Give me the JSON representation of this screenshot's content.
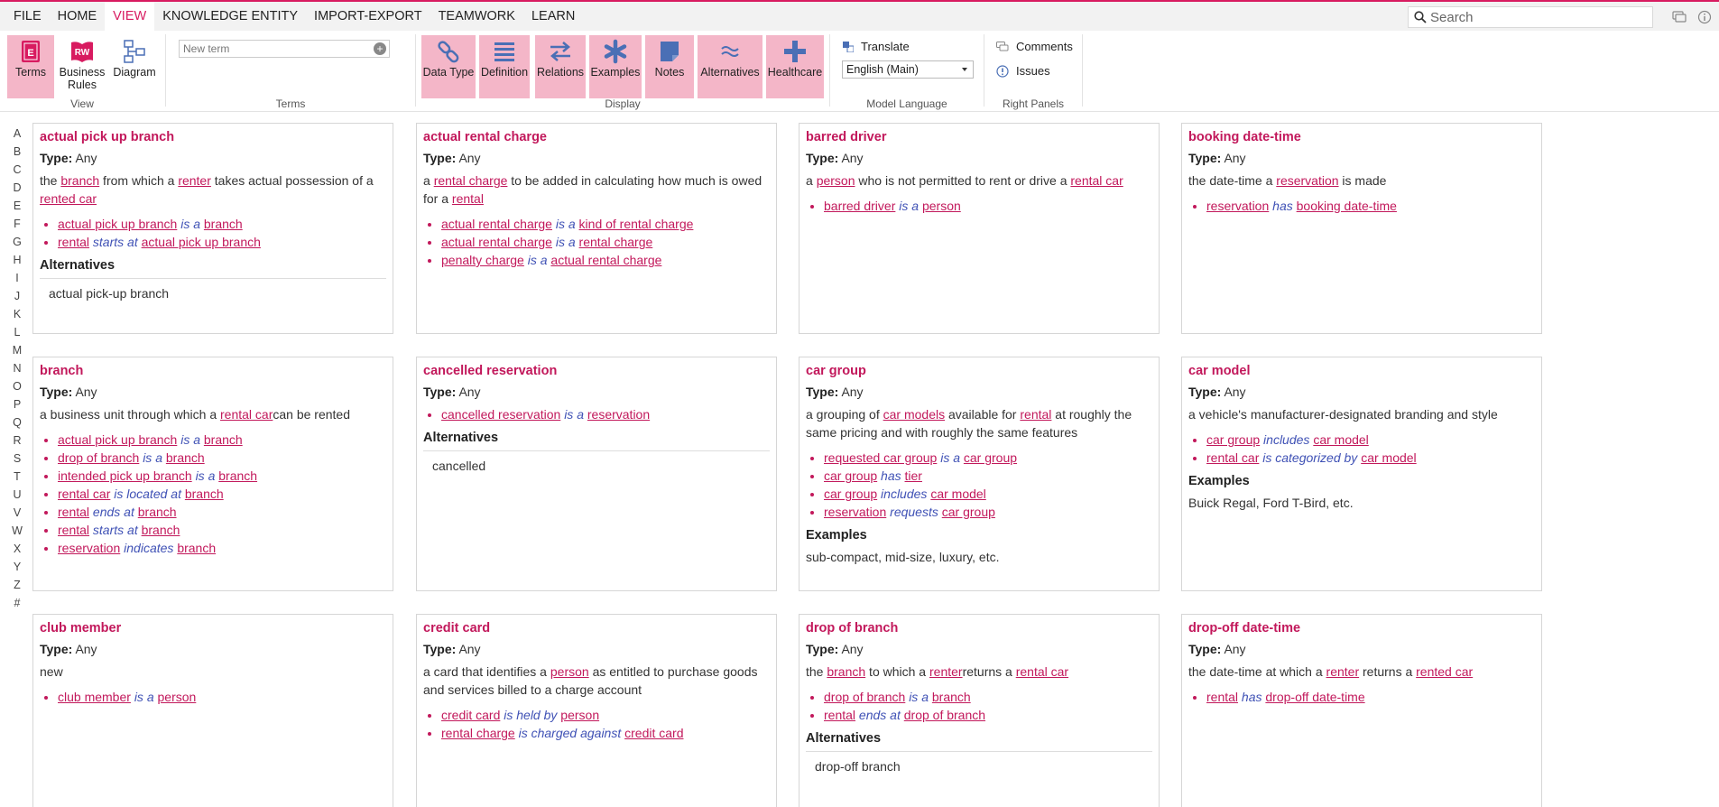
{
  "menu": [
    "FILE",
    "HOME",
    "VIEW",
    "KNOWLEDGE ENTITY",
    "IMPORT-EXPORT",
    "TEAMWORK",
    "LEARN"
  ],
  "search_placeholder": "Search",
  "ribbon": {
    "view_group": {
      "label": "View",
      "buttons": [
        "Terms",
        "Business Rules",
        "Diagram"
      ]
    },
    "terms_group": {
      "label": "Terms",
      "placeholder": "New term"
    },
    "display_group": {
      "label": "Display",
      "buttons": [
        "Data Type",
        "Definition",
        "Relations",
        "Examples",
        "Notes",
        "Alternatives",
        "Healthcare"
      ]
    },
    "model_language": {
      "label": "Model Language",
      "translate": "Translate",
      "selected": "English (Main)"
    },
    "right_panels": {
      "label": "Right Panels",
      "comments": "Comments",
      "issues": "Issues"
    }
  },
  "alphabet": [
    "A",
    "B",
    "C",
    "D",
    "E",
    "F",
    "G",
    "H",
    "I",
    "J",
    "K",
    "L",
    "M",
    "N",
    "O",
    "P",
    "Q",
    "R",
    "S",
    "T",
    "U",
    "V",
    "W",
    "X",
    "Y",
    "Z",
    "#"
  ],
  "labels": {
    "type": "Type:",
    "alternatives": "Alternatives",
    "examples": "Examples"
  },
  "cards": {
    "c1": {
      "title": "actual pick up branch",
      "type": "Any",
      "def": [
        "the ",
        "branch",
        " from which a ",
        "renter",
        " takes actual possession of a ",
        "rented car"
      ],
      "rels": [
        [
          "actual pick up branch",
          "is a",
          "branch"
        ],
        [
          "rental",
          "starts at",
          "actual pick up branch"
        ]
      ],
      "alt": "actual pick-up branch"
    },
    "c2": {
      "title": "actual rental charge",
      "type": "Any",
      "def": [
        "a ",
        "rental charge",
        " to be added in calculating how much is owed for a ",
        "rental",
        ""
      ],
      "rels": [
        [
          "actual rental charge",
          "is a",
          "kind of rental charge"
        ],
        [
          "actual rental charge",
          "is a",
          "rental charge"
        ],
        [
          "penalty charge",
          "is a",
          "actual rental charge"
        ]
      ]
    },
    "c3": {
      "title": "barred driver",
      "type": "Any",
      "def": [
        "a ",
        "person",
        " who is not permitted to rent or drive a ",
        "rental car",
        ""
      ],
      "rels": [
        [
          "barred driver",
          "is a",
          "person"
        ]
      ]
    },
    "c4": {
      "title": "booking date-time",
      "type": "Any",
      "def": [
        "the date-time a ",
        "reservation",
        " is made"
      ],
      "rels": [
        [
          "reservation",
          "has",
          "booking date-time"
        ]
      ]
    },
    "c5": {
      "title": "branch",
      "type": "Any",
      "def": [
        "a business unit through which a ",
        "rental car",
        "can be rented"
      ],
      "rels": [
        [
          "actual pick up branch",
          "is a",
          "branch"
        ],
        [
          "drop of branch",
          "is a",
          "branch"
        ],
        [
          "intended pick up branch",
          "is a",
          "branch"
        ],
        [
          "rental car",
          "is located at",
          "branch"
        ],
        [
          "rental",
          "ends at",
          "branch"
        ],
        [
          "rental",
          "starts at",
          "branch"
        ],
        [
          "reservation",
          "indicates",
          "branch"
        ]
      ]
    },
    "c6": {
      "title": "cancelled reservation",
      "type": "Any",
      "rels": [
        [
          "cancelled reservation",
          "is a",
          "reservation"
        ]
      ],
      "alt": "cancelled"
    },
    "c7": {
      "title": "car group",
      "type": "Any",
      "def": [
        "a grouping of ",
        "car models",
        " available for ",
        "rental",
        " at roughly the same pricing and with roughly the same features"
      ],
      "rels": [
        [
          "requested car group",
          "is a",
          "car group"
        ],
        [
          "car group",
          "has",
          "tier"
        ],
        [
          "car group",
          "includes",
          "car model"
        ],
        [
          "reservation",
          "requests",
          "car group"
        ]
      ],
      "examples": "sub-compact, mid-size, luxury, etc."
    },
    "c8": {
      "title": "car model",
      "type": "Any",
      "def": [
        "a vehicle's manufacturer-designated branding and style"
      ],
      "rels": [
        [
          "car group",
          "includes",
          "car model"
        ],
        [
          "rental car",
          "is categorized by",
          "car model"
        ]
      ],
      "examples": "Buick Regal, Ford T-Bird, etc."
    },
    "c9": {
      "title": "club member",
      "type": "Any",
      "def": [
        "new"
      ],
      "rels": [
        [
          "club member",
          "is a",
          "person"
        ]
      ]
    },
    "c10": {
      "title": "credit card",
      "type": "Any",
      "def": [
        "a card that identifies a ",
        "person",
        " as entitled to purchase goods and services billed to a charge account"
      ],
      "rels": [
        [
          "credit card",
          "is held by",
          "person"
        ],
        [
          "rental charge",
          "is charged against",
          "credit card"
        ]
      ]
    },
    "c11": {
      "title": "drop of branch",
      "type": "Any",
      "def": [
        "the ",
        "branch",
        " to which a ",
        "renter",
        "returns a ",
        "rental car",
        ""
      ],
      "rels": [
        [
          "drop of branch",
          "is a",
          "branch"
        ],
        [
          "rental",
          "ends at",
          "drop of branch"
        ]
      ],
      "alt": "drop-off branch"
    },
    "c12": {
      "title": "drop-off date-time",
      "type": "Any",
      "def": [
        "the date-time at which a ",
        "renter",
        " returns a ",
        "rented car"
      ],
      "rels": [
        [
          "rental",
          "has",
          "drop-off date-time"
        ]
      ]
    }
  }
}
